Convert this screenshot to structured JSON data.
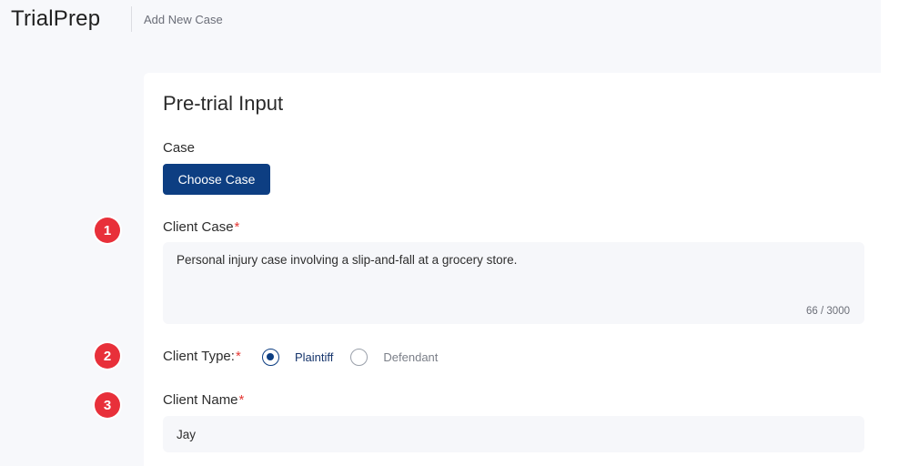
{
  "app": {
    "logo": "TrialPrep",
    "breadcrumb": "Add New Case"
  },
  "form": {
    "title": "Pre-trial Input",
    "case": {
      "label": "Case",
      "button_label": "Choose Case"
    },
    "client_case": {
      "step": "1",
      "label": "Client Case",
      "required_mark": "*",
      "value": "Personal injury case involving a slip-and-fall at a grocery store.",
      "char_count": "66 / 3000"
    },
    "client_type": {
      "step": "2",
      "label": "Client Type:",
      "required_mark": "*",
      "options": [
        {
          "label": "Plaintiff",
          "selected": true
        },
        {
          "label": "Defendant",
          "selected": false
        }
      ]
    },
    "client_name": {
      "step": "3",
      "label": "Client Name",
      "required_mark": "*",
      "value": "Jay"
    }
  },
  "colors": {
    "primary": "#0d3e82",
    "badge": "#e8303a",
    "required": "#e53935"
  }
}
